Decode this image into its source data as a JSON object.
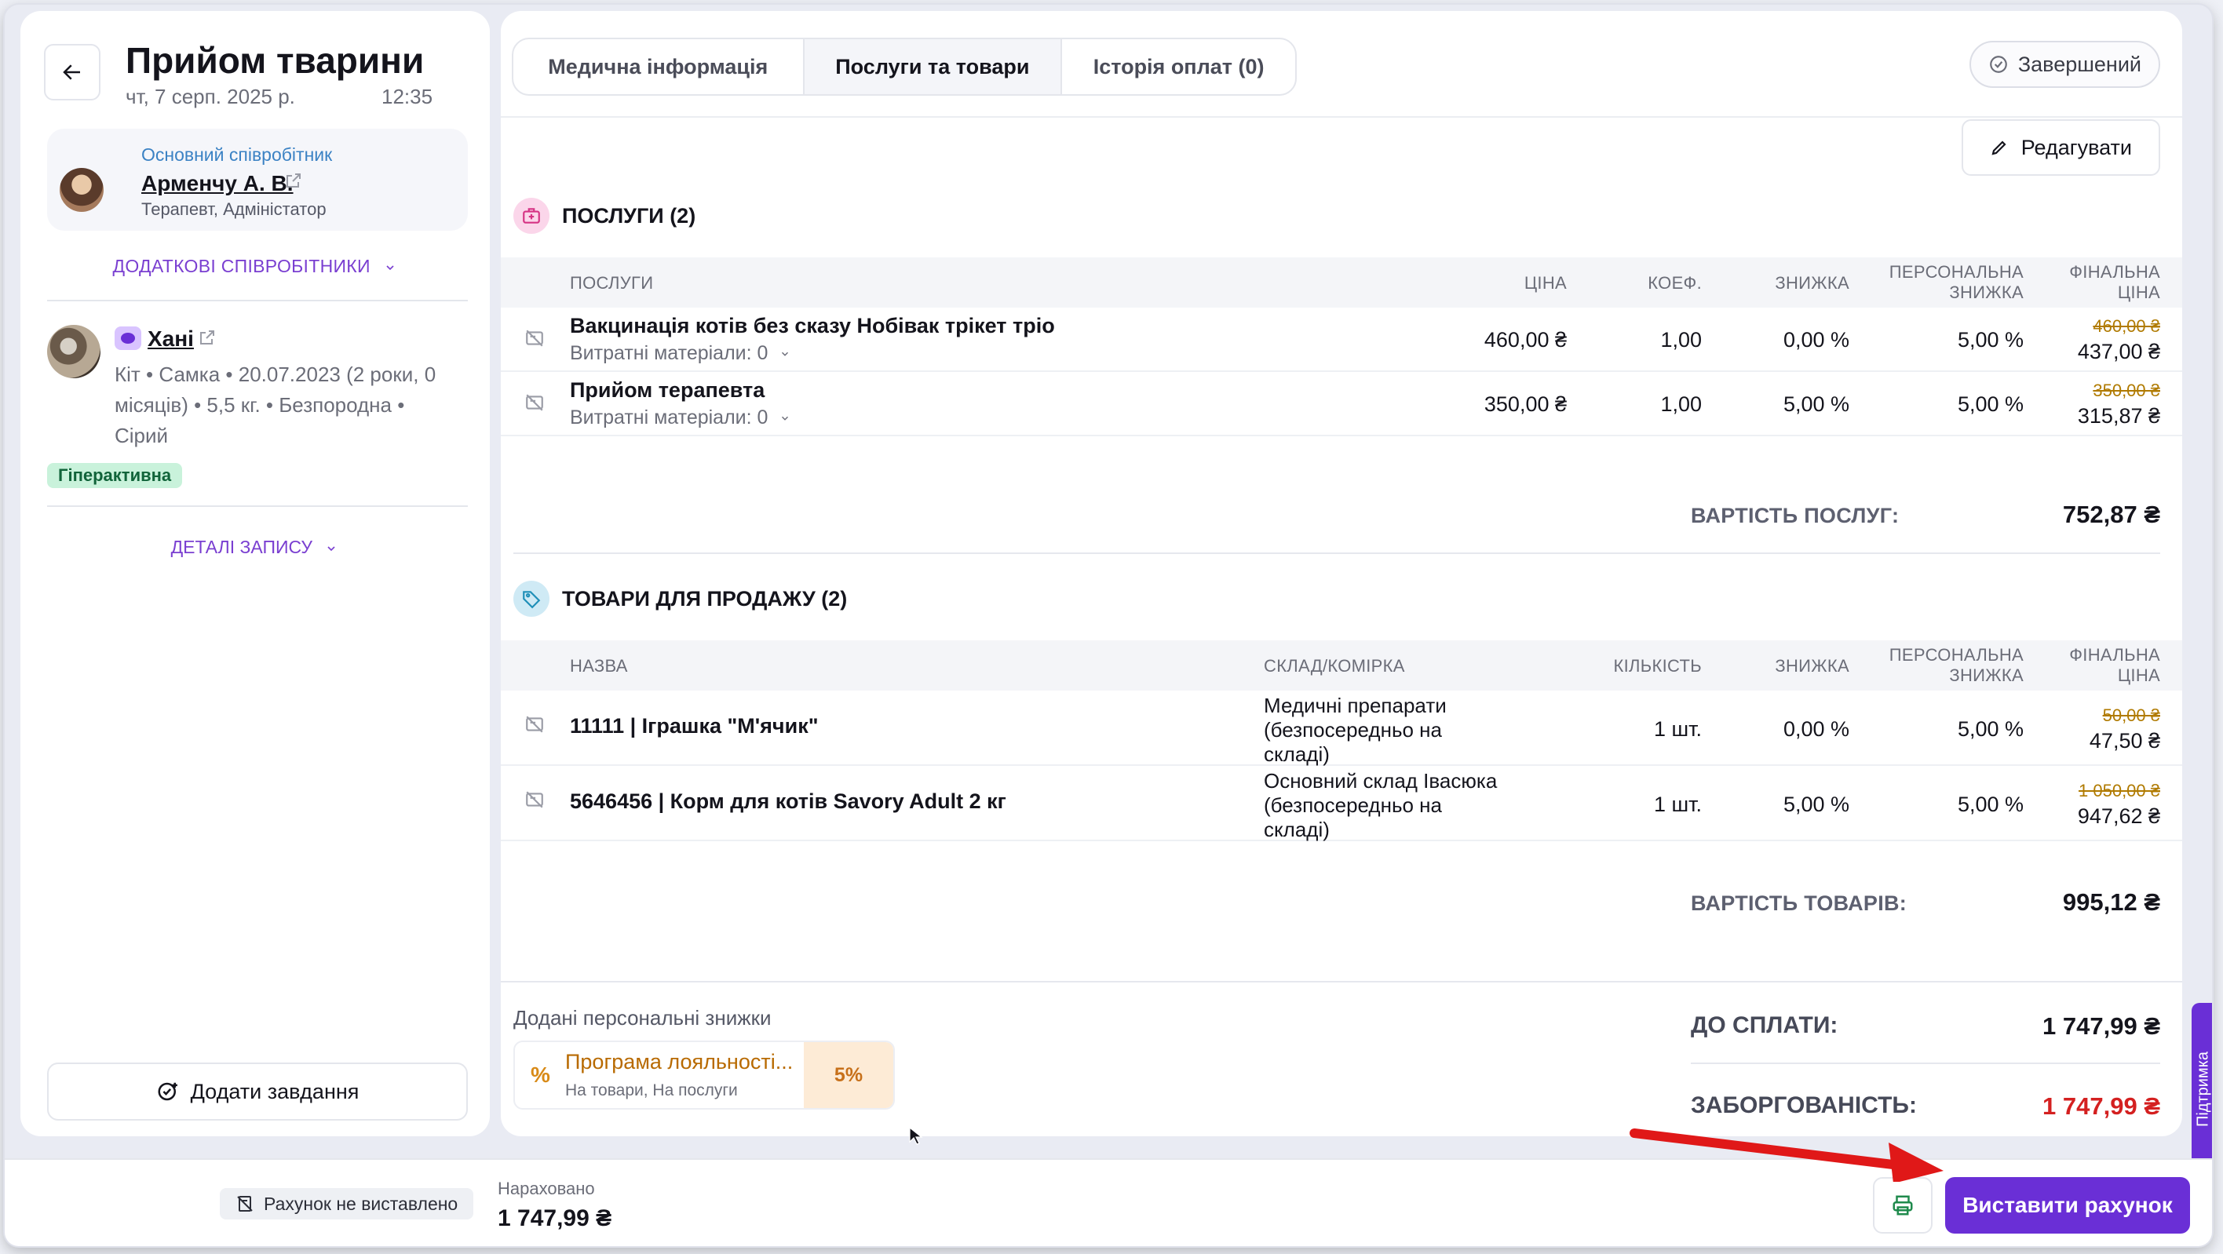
{
  "header": {
    "title": "Прийом тварини",
    "date": "чт, 7 серп. 2025 р.",
    "time": "12:35"
  },
  "employee": {
    "role_label": "Основний співробітник",
    "name": "Арменчу А. В.",
    "position": "Терапевт, Адміністатор",
    "additional_label": "ДОДАТКОВІ СПІВРОБІТНИКИ"
  },
  "pet": {
    "name": "Хані",
    "info": "Кіт • Самка • 20.07.2023 (2 роки, 0 місяців) • 5,5 кг. • Безпородна • Сірий",
    "tag": "Гіперактивна",
    "details_label": "ДЕТАЛІ ЗАПИСУ"
  },
  "add_task_label": "Додати завдання",
  "tabs": [
    {
      "label": "Медична інформація",
      "active": false
    },
    {
      "label": "Послуги та товари",
      "active": true
    },
    {
      "label": "Історія оплат (0)",
      "active": false
    }
  ],
  "status_label": "Завершений",
  "edit_label": "Редагувати",
  "services": {
    "title": "ПОСЛУГИ (2)",
    "columns": {
      "name": "ПОСЛУГИ",
      "price": "ЦІНА",
      "coef": "КОЕФ.",
      "discount": "ЗНИЖКА",
      "personal_1": "ПЕРСОНАЛЬНА",
      "personal_2": "ЗНИЖКА",
      "final_1": "ФІНАЛЬНА",
      "final_2": "ЦІНА"
    },
    "rows": [
      {
        "name": "Вакцинація котів без сказу Нобівак трікет тріо",
        "consumables": "Витратні матеріали: 0",
        "price": "460,00 ₴",
        "coef": "1,00",
        "discount": "0,00 %",
        "personal": "5,00 %",
        "old_price": "460,00 ₴",
        "final": "437,00 ₴"
      },
      {
        "name": "Прийом терапевта",
        "consumables": "Витратні матеріали: 0",
        "price": "350,00 ₴",
        "coef": "1,00",
        "discount": "5,00 %",
        "personal": "5,00 %",
        "old_price": "350,00 ₴",
        "final": "315,87 ₴"
      }
    ],
    "total_label": "ВАРТІСТЬ ПОСЛУГ:",
    "total": "752,87 ₴"
  },
  "goods": {
    "title": "ТОВАРИ ДЛЯ ПРОДАЖУ (2)",
    "columns": {
      "name": "НАЗВА",
      "warehouse": "СКЛАД/КОМІРКА",
      "qty": "КІЛЬКІСТЬ",
      "discount": "ЗНИЖКА",
      "personal_1": "ПЕРСОНАЛЬНА",
      "personal_2": "ЗНИЖКА",
      "final_1": "ФІНАЛЬНА",
      "final_2": "ЦІНА"
    },
    "rows": [
      {
        "name": "11111 | Іграшка \"М'ячик\"",
        "warehouse_1": "Медичні препарати",
        "warehouse_2": "(безпосередньо на",
        "warehouse_3": "складі)",
        "qty": "1 шт.",
        "discount": "0,00 %",
        "personal": "5,00 %",
        "old_price": "50,00 ₴",
        "final": "47,50 ₴"
      },
      {
        "name": "5646456 | Корм для котів Savory Adult 2 кг",
        "warehouse_1": "Основний склад Івасюка",
        "warehouse_2": "(безпосередньо на",
        "warehouse_3": "складі)",
        "qty": "1 шт.",
        "discount": "5,00 %",
        "personal": "5,00 %",
        "old_price": "1 050,00 ₴",
        "final": "947,62 ₴"
      }
    ],
    "total_label": "ВАРТІСТЬ ТОВАРІВ:",
    "total": "995,12 ₴"
  },
  "discounts": {
    "label": "Додані персональні знижки",
    "card_title": "Програма лояльності...",
    "card_sub": "На товари, На послуги",
    "card_value": "5%"
  },
  "summary": {
    "to_pay_label": "ДО СПЛАТИ:",
    "to_pay": "1 747,99 ₴",
    "debt_label": "ЗАБОРГОВАНІСТЬ:",
    "debt": "1 747,99 ₴"
  },
  "support_label": "Підтримка",
  "bottom": {
    "invoice_status": "Рахунок не виставлено",
    "accrued_label": "Нараховано",
    "accrued_value": "1 747,99 ₴",
    "invoice_button": "Виставити рахунок"
  },
  "colors": {
    "accent": "#6a2fd6",
    "debt": "#d42020",
    "annotation_arrow": "#e01818"
  }
}
